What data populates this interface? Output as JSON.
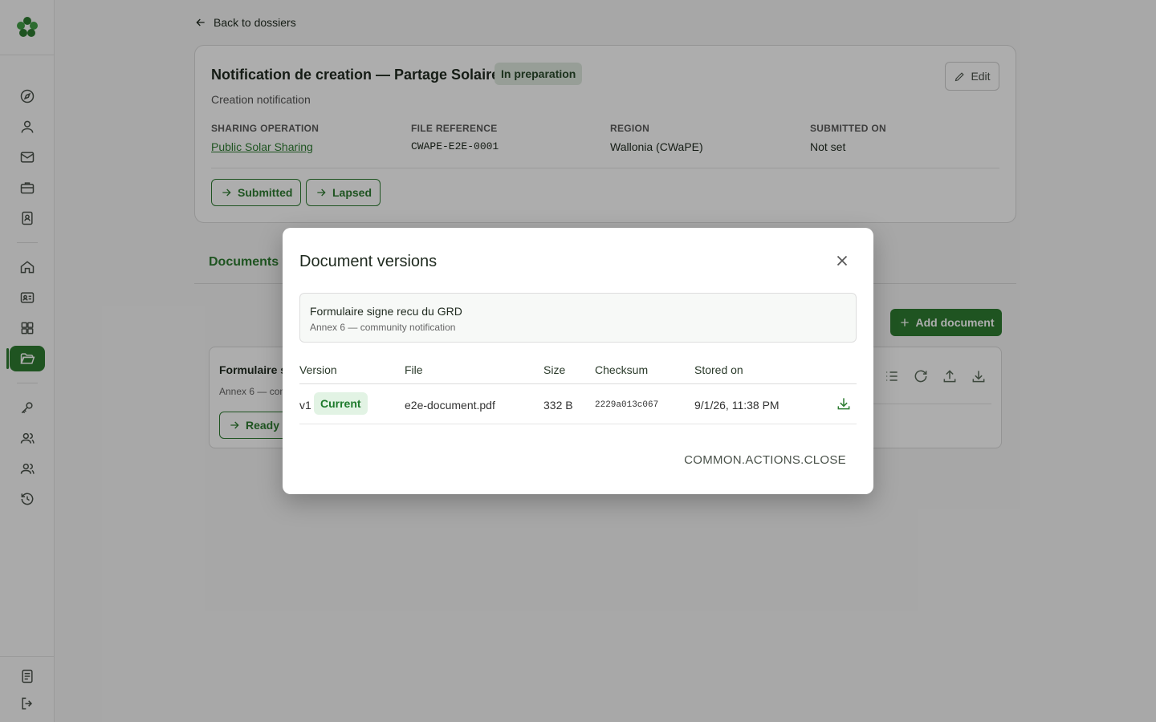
{
  "back_link": "Back to dossiers",
  "dossier": {
    "title": "Notification de creation — Partage Solaire",
    "status": "In preparation",
    "subtitle": "Creation notification",
    "edit_label": "Edit",
    "meta": [
      {
        "label": "SHARING OPERATION",
        "value": "Public Solar Sharing"
      },
      {
        "label": "FILE REFERENCE",
        "value": "CWAPE-E2E-0001"
      },
      {
        "label": "REGION",
        "value": "Wallonia (CWaPE)"
      },
      {
        "label": "SUBMITTED ON",
        "value": "Not set"
      }
    ],
    "transitions": [
      "Submitted",
      "Lapsed"
    ]
  },
  "tabs": {
    "documents": "Documents"
  },
  "add_document": "Add document",
  "document_card": {
    "title": "Formulaire s",
    "subtitle": "Annex 6 — com",
    "status_action": "Ready"
  },
  "modal": {
    "title": "Document versions",
    "document_title": "Formulaire signe recu du GRD",
    "document_subtitle": "Annex 6 — community notification",
    "columns": {
      "version": "Version",
      "file": "File",
      "size": "Size",
      "checksum": "Checksum",
      "stored_on": "Stored on"
    },
    "rows": [
      {
        "version": "v1",
        "badge": "Current",
        "file": "e2e-document.pdf",
        "size": "332 B",
        "checksum": "2229a013c067",
        "stored_on": "9/1/26, 11:38 PM"
      }
    ],
    "close_action": "COMMON.ACTIONS.CLOSE"
  },
  "colors": {
    "accent": "#2e7d32",
    "badge_bg": "#e2f3e4"
  }
}
